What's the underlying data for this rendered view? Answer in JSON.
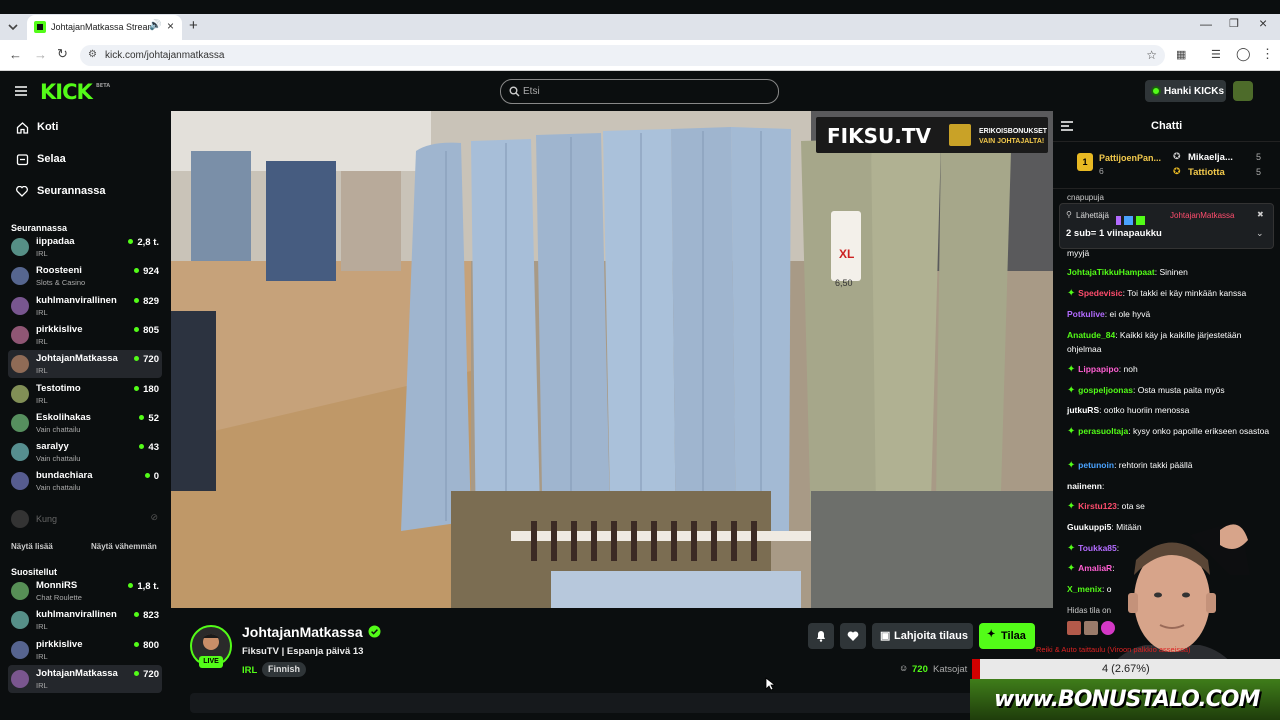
{
  "browser": {
    "tab_title": "JohtajanMatkassa Stream",
    "url": "kick.com/johtajanmatkassa"
  },
  "header": {
    "logo": "KICK",
    "logo_badge": "BETA",
    "search_placeholder": "Etsi",
    "kicks_button": "Hanki KICKs"
  },
  "sidebar": {
    "nav": [
      {
        "label": "Koti",
        "icon": "home-icon"
      },
      {
        "label": "Selaa",
        "icon": "browse-icon"
      },
      {
        "label": "Seurannassa",
        "icon": "heart-icon"
      }
    ],
    "following_title": "Seurannassa",
    "following": [
      {
        "name": "iippadaa",
        "category": "IRL",
        "viewers": "2,8 t."
      },
      {
        "name": "Roosteeni",
        "category": "Slots & Casino",
        "viewers": "924"
      },
      {
        "name": "kuhlmanvirallinen",
        "category": "IRL",
        "viewers": "829"
      },
      {
        "name": "pirkkislive",
        "category": "IRL",
        "viewers": "805"
      },
      {
        "name": "JohtajanMatkassa",
        "category": "IRL",
        "viewers": "720"
      },
      {
        "name": "Testotimo",
        "category": "IRL",
        "viewers": "180"
      },
      {
        "name": "Eskolihakas",
        "category": "Vain chattailu",
        "viewers": "52"
      },
      {
        "name": "saralyy",
        "category": "Vain chattailu",
        "viewers": "43"
      },
      {
        "name": "bundachiara",
        "category": "Vain chattailu",
        "viewers": "0"
      }
    ],
    "offline_channel": "Kung",
    "show_more": "Näytä lisää",
    "show_less": "Näytä vähemmän",
    "recommended_title": "Suositellut",
    "recommended": [
      {
        "name": "MonniRS",
        "category": "Chat Roulette",
        "viewers": "1,8 t."
      },
      {
        "name": "kuhlmanvirallinen",
        "category": "IRL",
        "viewers": "823"
      },
      {
        "name": "pirkkislive",
        "category": "IRL",
        "viewers": "800"
      },
      {
        "name": "JohtajanMatkassa",
        "category": "IRL",
        "viewers": "720"
      }
    ]
  },
  "video": {
    "brand": "FIKSU.TV",
    "brand_sub1": "ERIKOISBONUKSET",
    "brand_sub2": "VAIN JOHTAJALTA!",
    "price_tag": "XL",
    "price_value": "6,50"
  },
  "stream": {
    "channel": "JohtajanMatkassa",
    "live_badge": "LIVE",
    "title": "FiksuTV | Espanja päivä 13",
    "category": "IRL",
    "language": "Finnish",
    "gift_button": "Lahjoita tilaus",
    "subscribe_button": "Tilaa",
    "viewers": "720",
    "viewers_label": "Katsojat"
  },
  "chat": {
    "title": "Chatti",
    "leaderboard": [
      {
        "rank": "1",
        "name": "PattijoenPan...",
        "count": "6"
      },
      {
        "name": "Mikaelja...",
        "count": "5"
      },
      {
        "name": "Tattiotta",
        "count": "5"
      }
    ],
    "partial_top": "cnapupuja",
    "pinned_sender_label": "Lähettäjä",
    "pinned_sender": "JohtajanMatkassa",
    "pinned_text": "2 sub= 1 viinapaukku",
    "partial_line": "myyjä",
    "messages": [
      {
        "user": "JohtajaTikkuHampaat",
        "color": "#53fc18",
        "text": "Sininen",
        "badge": false
      },
      {
        "user": "Spedevisic",
        "color": "#ff4d6d",
        "text": "Toi takki ei käy minkään kanssa",
        "badge": true
      },
      {
        "user": "Potkulive",
        "color": "#b36bff",
        "text": "ei ole hyvä",
        "badge": false
      },
      {
        "user": "Anatude_84",
        "color": "#53fc18",
        "text": "Kaikki käy ja kaikille järjestetään ohjelmaa",
        "badge": false
      },
      {
        "user": "Lippapipo",
        "color": "#ff5fd2",
        "text": "noh",
        "badge": true
      },
      {
        "user": "gospeljoonas",
        "color": "#53fc18",
        "text": "Osta musta paita myös",
        "badge": true
      },
      {
        "user": "jutkuRS",
        "color": "#ffffff",
        "text": "ootko huoriin menossa",
        "badge": false
      },
      {
        "user": "perasuoltaja",
        "color": "#53fc18",
        "text": "kysy onko papoille erikseen osastoa",
        "badge": true
      },
      {
        "user": "petunoin",
        "color": "#4aa3ff",
        "text": "rehtorin takki päällä",
        "badge": true
      },
      {
        "user": "naiinenn",
        "color": "#ffffff",
        "text": "",
        "badge": false
      },
      {
        "user": "Kirstu123",
        "color": "#ff4d6d",
        "text": "ota se",
        "badge": true
      },
      {
        "user": "Guukuppi5",
        "color": "#ffffff",
        "text": "Mitään",
        "badge": false
      },
      {
        "user": "Toukka85",
        "color": "#b36bff",
        "text": "",
        "badge": true
      },
      {
        "user": "AmaliaR",
        "color": "#ff5fd2",
        "text": "",
        "badge": true
      },
      {
        "user": "X_menix",
        "color": "#53fc18",
        "text": "o",
        "badge": false
      }
    ],
    "slow_mode": "Hidas tila on"
  },
  "overlays": {
    "poll_text": "Reiki & Auto taittaulu (Viroon palkkio asseissa)",
    "poll_result": "4 (2.67%)",
    "bonus_banner": "www.BONUSTALO.COM"
  }
}
